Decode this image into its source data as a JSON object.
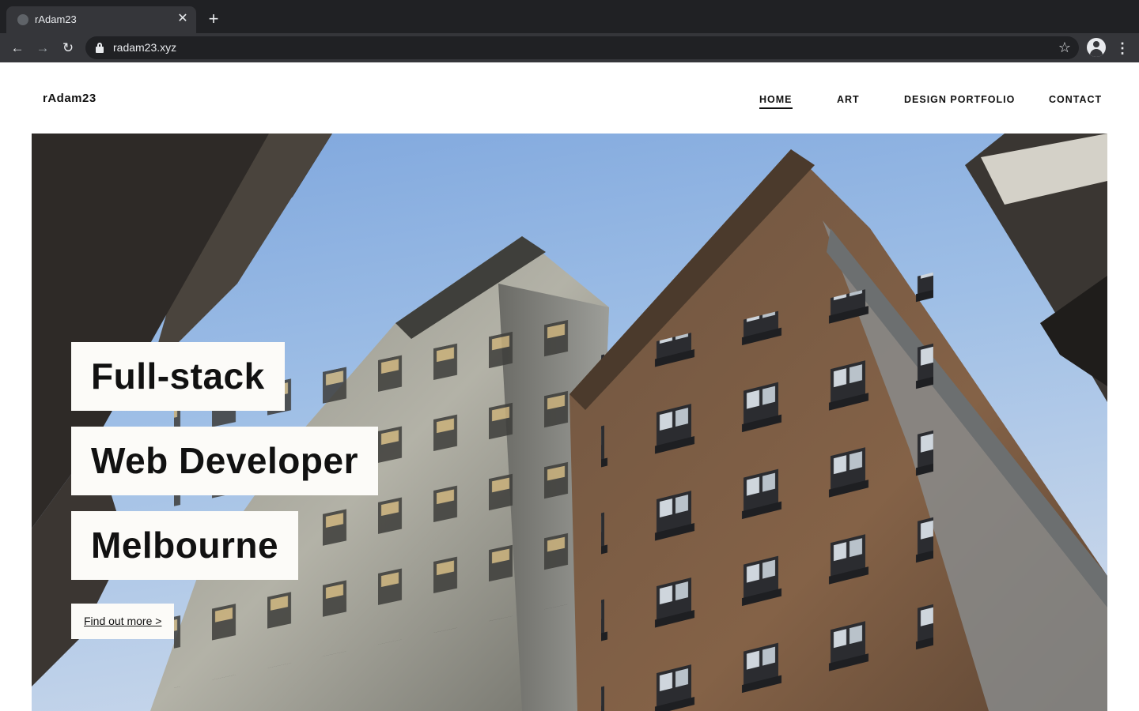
{
  "browser": {
    "tab_title": "rAdam23",
    "tab_close": "✕",
    "new_tab": "+",
    "url": "radam23.xyz",
    "back": "←",
    "forward": "→",
    "reload": "↻",
    "star": "☆",
    "menu": "⋮"
  },
  "site": {
    "logo": "rAdam23",
    "nav": {
      "home": "HOME",
      "art": "ART",
      "design": "DESIGN PORTFOLIO",
      "contact": "CONTACT"
    },
    "hero": {
      "line1": "Full-stack",
      "line2": "Web Developer",
      "line3": "Melbourne",
      "cta": "Find out more >"
    }
  },
  "colors": {
    "chrome_dark": "#202124",
    "chrome_toolbar": "#35363a",
    "headline_box": "#fcfbf8",
    "sky": "#8fb3e2",
    "brick": "#7a5b42",
    "stone": "#a7a69b"
  },
  "icons": [
    "globe-icon",
    "close-icon",
    "plus-icon",
    "back-arrow-icon",
    "forward-arrow-icon",
    "reload-icon",
    "lock-icon",
    "star-icon",
    "profile-icon",
    "menu-dots-icon"
  ]
}
